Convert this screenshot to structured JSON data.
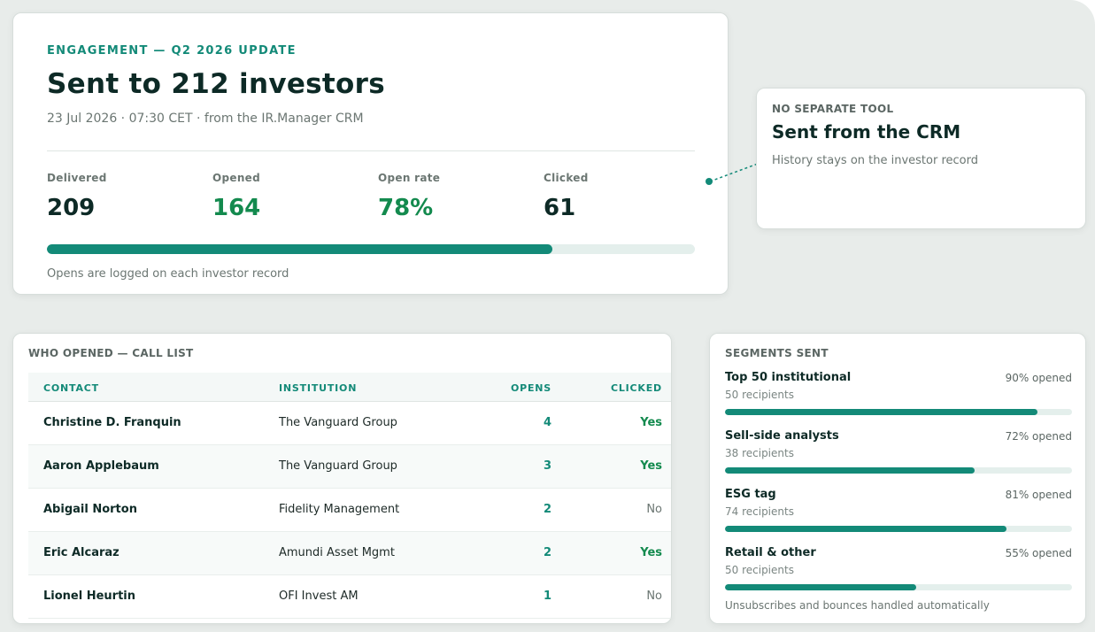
{
  "engagement": {
    "eyebrow": "ENGAGEMENT — Q2 2026 UPDATE",
    "headline": "Sent to 212 investors",
    "subline": "23 Jul 2026 · 07:30 CET · from the IR.Manager CRM",
    "stats": [
      {
        "label": "Delivered",
        "value": "209"
      },
      {
        "label": "Opened",
        "value": "164"
      },
      {
        "label": "Open rate",
        "value": "78%"
      },
      {
        "label": "Clicked",
        "value": "61"
      }
    ],
    "progress_fraction": 0.78,
    "footnote": "Opens are logged on each investor record"
  },
  "callout": {
    "eyebrow": "NO SEPARATE TOOL",
    "title": "Sent from the CRM",
    "text": "History stays on the investor record"
  },
  "call_list": {
    "title": "WHO OPENED — CALL LIST",
    "headers": {
      "contact": "CONTACT",
      "institution": "INSTITUTION",
      "opens": "OPENS",
      "clicked": "CLICKED"
    },
    "rows": [
      {
        "contact": "Christine D. Franquin",
        "institution": "The Vanguard Group",
        "opens": "4",
        "clicked": "Yes"
      },
      {
        "contact": "Aaron Applebaum",
        "institution": "The Vanguard Group",
        "opens": "3",
        "clicked": "Yes"
      },
      {
        "contact": "Abigail Norton",
        "institution": "Fidelity Management",
        "opens": "2",
        "clicked": "No"
      },
      {
        "contact": "Eric Alcaraz",
        "institution": "Amundi Asset Mgmt",
        "opens": "2",
        "clicked": "Yes"
      },
      {
        "contact": "Lionel Heurtin",
        "institution": "OFI Invest AM",
        "opens": "1",
        "clicked": "No"
      }
    ]
  },
  "segments": {
    "title": "SEGMENTS SENT",
    "items": [
      {
        "name": "Top 50 institutional",
        "count": "50 recipients",
        "rate": "90% opened",
        "fraction": 0.9
      },
      {
        "name": "Sell-side analysts",
        "count": "38 recipients",
        "rate": "72% opened",
        "fraction": 0.72
      },
      {
        "name": "ESG tag",
        "count": "74 recipients",
        "rate": "81% opened",
        "fraction": 0.81
      },
      {
        "name": "Retail & other",
        "count": "50 recipients",
        "rate": "55% opened",
        "fraction": 0.55
      }
    ],
    "footnote": "Unsubscribes and bounces handled automatically"
  },
  "colors": {
    "accent": "#138a78",
    "positive": "#138a4e",
    "ink": "#0d2a26"
  }
}
